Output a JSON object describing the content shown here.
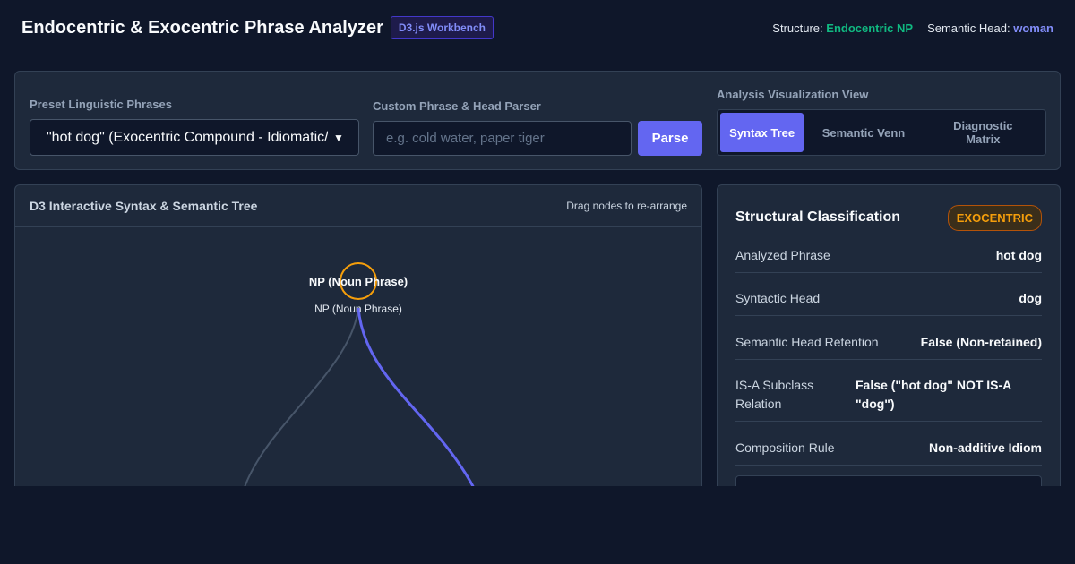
{
  "header": {
    "title": "Endocentric & Exocentric Phrase Analyzer",
    "badge": "D3.js Workbench",
    "structure_label": "Structure:",
    "structure_value": "Endocentric NP",
    "head_label": "Semantic Head:",
    "head_value": "woman"
  },
  "controls": {
    "preset_label": "Preset Linguistic Phrases",
    "preset_selected": "\"hot dog\" (Exocentric Compound - Idiomatic/Me",
    "custom_label": "Custom Phrase & Head Parser",
    "custom_placeholder": "e.g. cold water, paper tiger",
    "parse_button": "Parse",
    "view_label": "Analysis Visualization View",
    "views": [
      {
        "label": "Syntax Tree",
        "active": true
      },
      {
        "label": "Semantic Venn",
        "active": false
      },
      {
        "label": "Diagnostic Matrix",
        "active": false
      }
    ]
  },
  "tree": {
    "title": "D3 Interactive Syntax & Semantic Tree",
    "hint": "Drag nodes to re-arrange",
    "root_label": "NP (Noun Phrase)",
    "root_sublabel": "NP (Noun Phrase)",
    "colors": {
      "head_link": "#6366f1",
      "other_link": "#475569",
      "root_node": "#f59e0b"
    }
  },
  "classification": {
    "title": "Structural Classification",
    "badge": "EXOCENTRIC",
    "rows": [
      {
        "key": "Analyzed Phrase",
        "value": "hot dog"
      },
      {
        "key": "Syntactic Head",
        "value": "dog"
      },
      {
        "key": "Semantic Head Retention",
        "value": "False (Non-retained)"
      },
      {
        "key": "IS-A Subclass Relation",
        "value": "False (\"hot dog\" NOT IS-A \"dog\")"
      },
      {
        "key": "Composition Rule",
        "value": "Non-additive Idiom"
      }
    ]
  }
}
